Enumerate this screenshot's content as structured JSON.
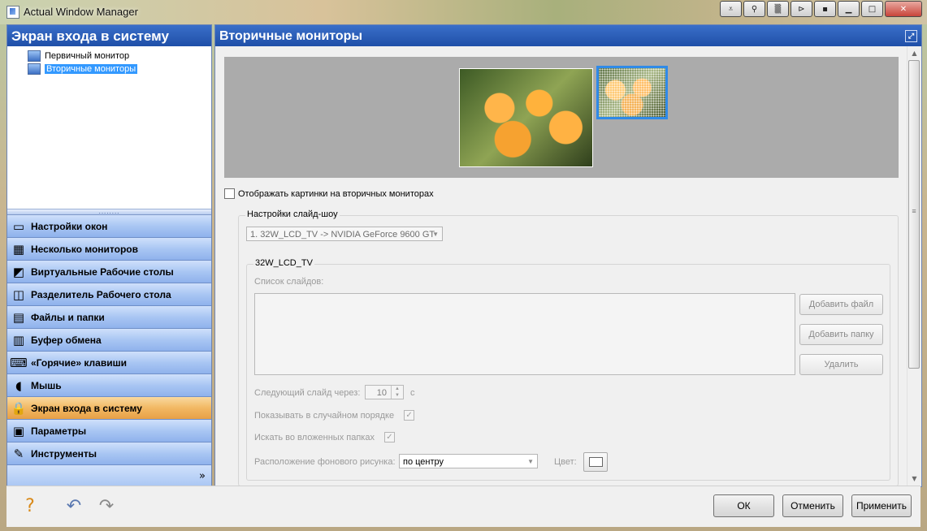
{
  "window": {
    "title": "Actual Window Manager"
  },
  "left": {
    "header": "Экран входа в систему",
    "tree": [
      {
        "label": "Первичный монитор"
      },
      {
        "label": "Вторичные мониторы"
      }
    ],
    "nav": [
      {
        "label": "Настройки окон",
        "icon": "window-settings-icon",
        "glyph": "▭"
      },
      {
        "label": "Несколько мониторов",
        "icon": "multi-monitor-icon",
        "glyph": "▦"
      },
      {
        "label": "Виртуальные Рабочие столы",
        "icon": "virtual-desktops-icon",
        "glyph": "◩"
      },
      {
        "label": "Разделитель Рабочего стола",
        "icon": "desktop-divider-icon",
        "glyph": "◫"
      },
      {
        "label": "Файлы и папки",
        "icon": "files-folders-icon",
        "glyph": "▤"
      },
      {
        "label": "Буфер обмена",
        "icon": "clipboard-icon",
        "glyph": "▥"
      },
      {
        "label": "«Горячие» клавиши",
        "icon": "keyboard-icon",
        "glyph": "⌨"
      },
      {
        "label": "Мышь",
        "icon": "mouse-icon",
        "glyph": "◖"
      },
      {
        "label": "Экран входа в систему",
        "icon": "lock-icon",
        "glyph": "🔒"
      },
      {
        "label": "Параметры",
        "icon": "parameters-icon",
        "glyph": "▣"
      },
      {
        "label": "Инструменты",
        "icon": "tools-icon",
        "glyph": "✎"
      }
    ],
    "more": "»"
  },
  "right": {
    "header": "Вторичные мониторы",
    "show_pictures_label": "Отображать картинки на вторичных мониторах",
    "slideshow": {
      "legend": "Настройки слайд-шоу",
      "monitor_select": "1. 32W_LCD_TV -> NVIDIA GeForce 9600 GT",
      "group_legend": "32W_LCD_TV",
      "slide_list_label": "Список слайдов:",
      "add_file": "Добавить файл",
      "add_folder": "Добавить папку",
      "delete": "Удалить",
      "next_slide_label": "Следующий слайд через:",
      "next_slide_value": "10",
      "next_slide_unit": "с",
      "random_order_label": "Показывать в случайном порядке",
      "random_order_checked": true,
      "subfolders_label": "Искать во вложенных папках",
      "subfolders_checked": true,
      "position_label": "Расположение фонового рисунка:",
      "position_value": "по центру",
      "color_label": "Цвет:"
    }
  },
  "bottom": {
    "ok": "ОК",
    "cancel": "Отменить",
    "apply": "Применить"
  }
}
